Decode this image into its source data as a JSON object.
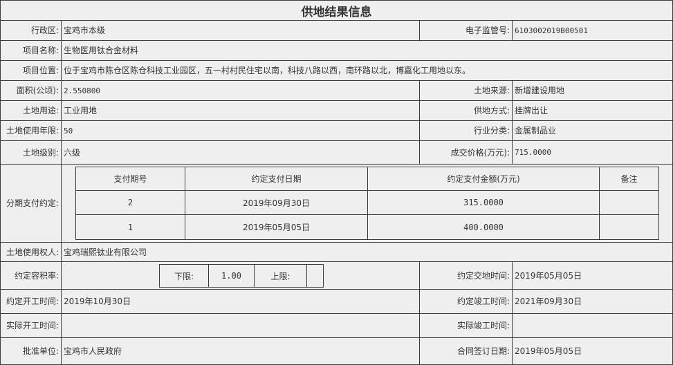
{
  "title": "供地结果信息",
  "row1": {
    "label_l": "行政区:",
    "value_l": "宝鸡市本级",
    "label_r": "电子监管号:",
    "value_r": "6103002019B00501"
  },
  "row2": {
    "label": "项目名称:",
    "value": "生物医用钛合金材料"
  },
  "row3": {
    "label": "项目位置:",
    "value": "位于宝鸡市陈仓区陈仓科技工业园区，五一村村民住宅以南，科技八路以西，南环路以北，博嘉化工用地以东。"
  },
  "row4": {
    "label_l": "面积(公顷):",
    "value_l": "2.550800",
    "label_r": "土地来源:",
    "value_r": "新增建设用地"
  },
  "row5": {
    "label_l": "土地用途:",
    "value_l": "工业用地",
    "label_r": "供地方式:",
    "value_r": "挂牌出让"
  },
  "row6": {
    "label_l": "土地使用年限:",
    "value_l": "50",
    "label_r": "行业分类:",
    "value_r": "金属制品业"
  },
  "row7": {
    "label_l": "土地级别:",
    "value_l": "六级",
    "label_r": "成交价格(万元):",
    "value_r": "715.0000"
  },
  "installments": {
    "label": "分期支付约定:",
    "headers": [
      "支付期号",
      "约定支付日期",
      "约定支付金额(万元)",
      "备注"
    ],
    "rows": [
      {
        "no": "2",
        "date": "2019年09月30日",
        "amount": "315.0000",
        "note": ""
      },
      {
        "no": "1",
        "date": "2019年05月05日",
        "amount": "400.0000",
        "note": ""
      }
    ]
  },
  "row9": {
    "label": "土地使用权人:",
    "value": "宝鸡瑞熙钛业有限公司"
  },
  "row10": {
    "label_l": "约定容积率:",
    "lower_label": "下限:",
    "lower_value": "1.00",
    "upper_label": "上限:",
    "upper_value": "",
    "label_r": "约定交地时间:",
    "value_r": "2019年05月05日"
  },
  "row11": {
    "label_l": "约定开工时间:",
    "value_l": "2019年10月30日",
    "label_r": "约定竣工时间:",
    "value_r": "2021年09月30日"
  },
  "row12": {
    "label_l": "实际开工时间:",
    "value_l": "",
    "label_r": "实际竣工时间:",
    "value_r": ""
  },
  "row13": {
    "label_l": "批准单位:",
    "value_l": "宝鸡市人民政府",
    "label_r": "合同签订日期:",
    "value_r": "2019年05月05日"
  }
}
